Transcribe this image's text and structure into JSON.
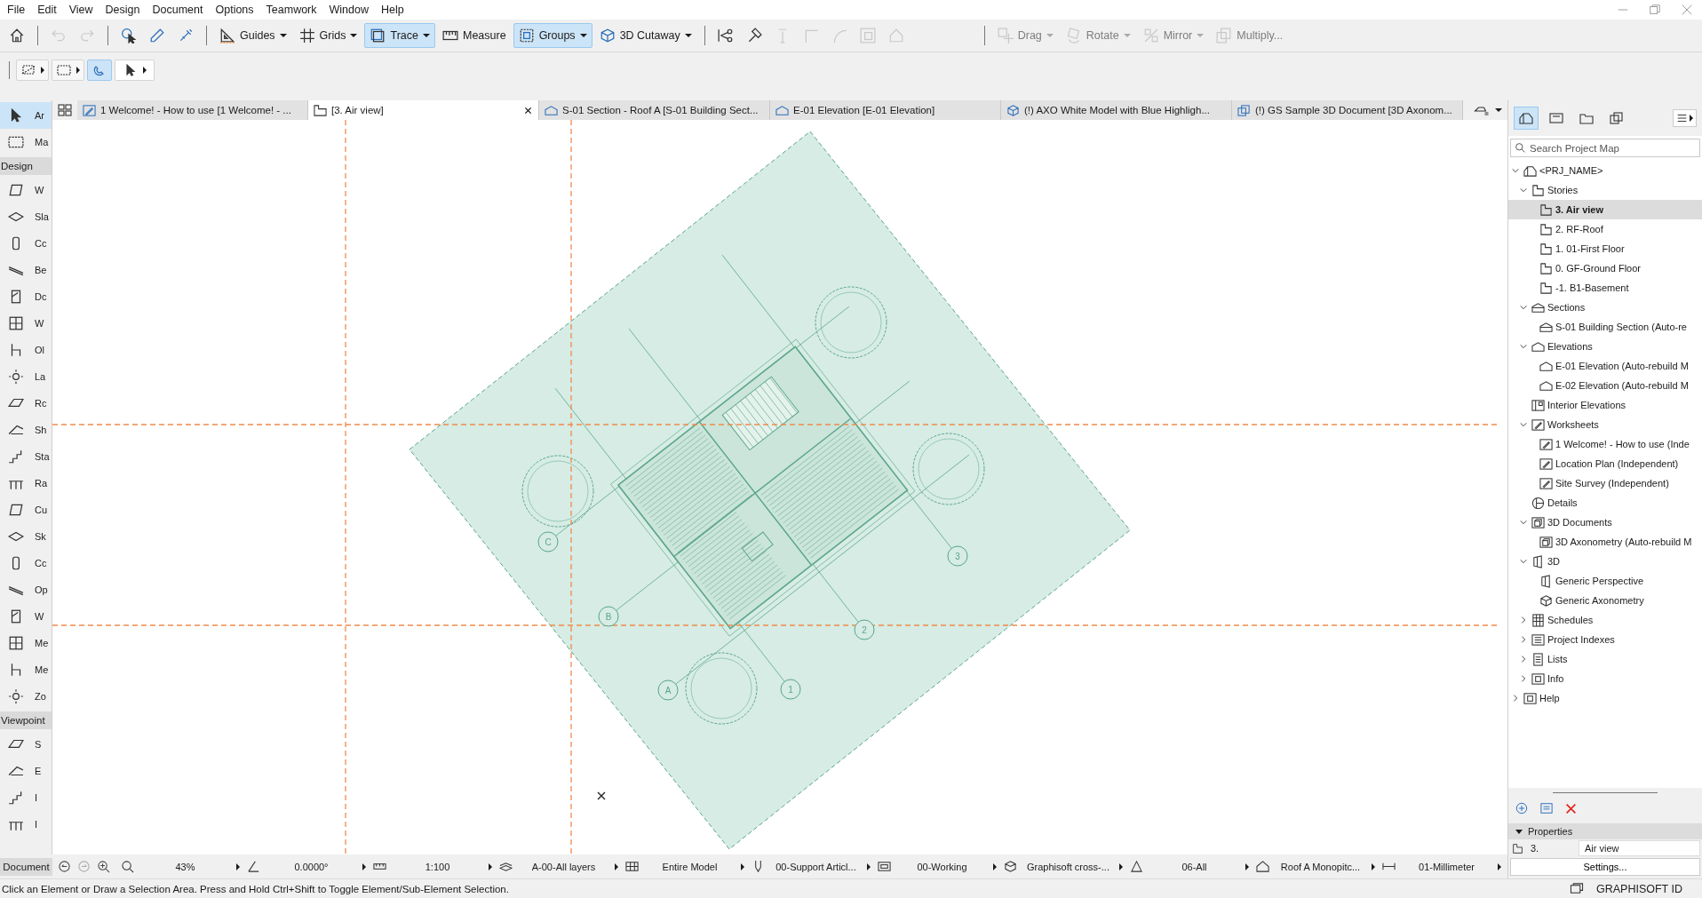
{
  "menu": [
    "File",
    "Edit",
    "View",
    "Design",
    "Document",
    "Options",
    "Teamwork",
    "Window",
    "Help"
  ],
  "toolbar": {
    "items": [
      {
        "kind": "button",
        "selected": false,
        "disabled": false
      },
      {
        "kind": "separator"
      },
      {
        "kind": "button",
        "selected": false,
        "disabled": true
      },
      {
        "kind": "button",
        "selected": false,
        "disabled": true
      },
      {
        "kind": "separator"
      },
      {
        "kind": "button",
        "selected": false,
        "disabled": false
      },
      {
        "kind": "button",
        "selected": false,
        "disabled": false
      },
      {
        "kind": "button",
        "selected": false,
        "disabled": false
      },
      {
        "kind": "separator"
      },
      {
        "kind": "button",
        "label": "Guides",
        "dropdown": true,
        "selected": false,
        "disabled": false
      },
      {
        "kind": "button",
        "label": "Grids",
        "dropdown": true,
        "selected": false,
        "disabled": false
      },
      {
        "kind": "button",
        "label": "Trace",
        "dropdown": true,
        "selected": true,
        "disabled": false
      },
      {
        "kind": "button",
        "label": "Measure",
        "selected": false,
        "disabled": false
      },
      {
        "kind": "button",
        "label": "Groups",
        "dropdown": true,
        "selected": true,
        "disabled": false
      },
      {
        "kind": "button",
        "label": "3D Cutaway",
        "dropdown": true,
        "selected": false,
        "disabled": false
      },
      {
        "kind": "separator"
      },
      {
        "kind": "button",
        "selected": false,
        "disabled": false
      },
      {
        "kind": "button",
        "selected": false,
        "disabled": false
      },
      {
        "kind": "button",
        "selected": false,
        "disabled": true
      },
      {
        "kind": "button",
        "selected": false,
        "disabled": true
      },
      {
        "kind": "button",
        "selected": false,
        "disabled": true
      },
      {
        "kind": "button",
        "selected": false,
        "disabled": true
      },
      {
        "kind": "button",
        "selected": false,
        "disabled": true
      },
      {
        "kind": "spacer"
      },
      {
        "kind": "separator"
      },
      {
        "kind": "button",
        "label": "Drag",
        "dropdown": true,
        "selected": false,
        "disabled": true
      },
      {
        "kind": "button",
        "label": "Rotate",
        "dropdown": true,
        "selected": false,
        "disabled": true
      },
      {
        "kind": "button",
        "label": "Mirror",
        "dropdown": true,
        "selected": false,
        "disabled": true
      },
      {
        "kind": "button",
        "label": "Multiply...",
        "selected": false,
        "disabled": true
      }
    ]
  },
  "info_box": [
    {
      "dropdown": true,
      "selected": false
    },
    {
      "dropdown": true,
      "selected": false
    },
    {
      "selected": true
    },
    {
      "dropdown": true,
      "selected": false
    }
  ],
  "tabs": [
    {
      "label": "1 Welcome! - How to use [1 Welcome! - ...",
      "selected": false
    },
    {
      "label": "[3. Air view]",
      "selected": true
    },
    {
      "label": "S-01 Section - Roof A [S-01 Building Sect...",
      "selected": false
    },
    {
      "label": "E-01 Elevation [E-01 Elevation]",
      "selected": false
    },
    {
      "label": "(!) AXO White Model with Blue Highligh...",
      "selected": false
    },
    {
      "label": "(!) GS Sample 3D Document [3D Axonom...",
      "selected": false
    }
  ],
  "toolbox": {
    "items": [
      {
        "kind": "tool",
        "label": "Ar",
        "selected": true
      },
      {
        "kind": "tool",
        "label": "Ma",
        "selected": false
      },
      {
        "kind": "header",
        "label": "Design"
      },
      {
        "kind": "tool",
        "label": "W",
        "selected": false
      },
      {
        "kind": "tool",
        "label": "Sla",
        "selected": false
      },
      {
        "kind": "tool",
        "label": "Cc",
        "selected": false
      },
      {
        "kind": "tool",
        "label": "Be",
        "selected": false
      },
      {
        "kind": "tool",
        "label": "Dc",
        "selected": false
      },
      {
        "kind": "tool",
        "label": "W",
        "selected": false
      },
      {
        "kind": "tool",
        "label": "Ol",
        "selected": false
      },
      {
        "kind": "tool",
        "label": "La",
        "selected": false
      },
      {
        "kind": "tool",
        "label": "Rc",
        "selected": false
      },
      {
        "kind": "tool",
        "label": "Sh",
        "selected": false
      },
      {
        "kind": "tool",
        "label": "Sta",
        "selected": false
      },
      {
        "kind": "tool",
        "label": "Ra",
        "selected": false
      },
      {
        "kind": "tool",
        "label": "Cu",
        "selected": false
      },
      {
        "kind": "tool",
        "label": "Sk",
        "selected": false
      },
      {
        "kind": "tool",
        "label": "Cc",
        "selected": false
      },
      {
        "kind": "tool",
        "label": "Op",
        "selected": false
      },
      {
        "kind": "tool",
        "label": "W",
        "selected": false
      },
      {
        "kind": "tool",
        "label": "Me",
        "selected": false
      },
      {
        "kind": "tool",
        "label": "Me",
        "selected": false
      },
      {
        "kind": "tool",
        "label": "Zo",
        "selected": false
      },
      {
        "kind": "header",
        "label": "Viewpoint"
      },
      {
        "kind": "tool",
        "label": "S",
        "selected": false
      },
      {
        "kind": "tool",
        "label": "E",
        "selected": false
      },
      {
        "kind": "tool",
        "label": "I",
        "selected": false
      },
      {
        "kind": "tool",
        "label": "I",
        "selected": false
      }
    ]
  },
  "canvas": {
    "grid_bubbles": [
      "C",
      "B",
      "A",
      "1",
      "2",
      "3"
    ]
  },
  "project_map": {
    "views": [
      {
        "selected": true
      },
      {
        "selected": false
      },
      {
        "selected": false
      },
      {
        "selected": false
      }
    ],
    "search": {
      "placeholder": "Search Project Map"
    },
    "tree": [
      {
        "label": "<PRJ_NAME>",
        "kind": "project",
        "expanded": true,
        "selected": false,
        "children": [
          {
            "label": "Stories",
            "kind": "story",
            "expanded": true,
            "selected": false,
            "children": [
              {
                "label": "3. Air view",
                "kind": "story",
                "selected": true
              },
              {
                "label": "2. RF-Roof",
                "kind": "story",
                "selected": false
              },
              {
                "label": "1. 01-First Floor",
                "kind": "story",
                "selected": false
              },
              {
                "label": "0. GF-Ground Floor",
                "kind": "story",
                "selected": false
              },
              {
                "label": "-1. B1-Basement",
                "kind": "story",
                "selected": false
              }
            ]
          },
          {
            "label": "Sections",
            "kind": "section",
            "expanded": true,
            "selected": false,
            "children": [
              {
                "label": "S-01 Building Section (Auto-re",
                "kind": "section",
                "selected": false
              }
            ]
          },
          {
            "label": "Elevations",
            "kind": "elevation",
            "expanded": true,
            "selected": false,
            "children": [
              {
                "label": "E-01 Elevation (Auto-rebuild M",
                "kind": "elevation",
                "selected": false
              },
              {
                "label": "E-02 Elevation (Auto-rebuild M",
                "kind": "elevation",
                "selected": false
              }
            ]
          },
          {
            "label": "Interior Elevations",
            "kind": "interior",
            "selected": false
          },
          {
            "label": "Worksheets",
            "kind": "worksheet",
            "expanded": true,
            "selected": false,
            "children": [
              {
                "label": "1 Welcome! - How to use (Inde",
                "kind": "worksheet",
                "selected": false
              },
              {
                "label": "Location Plan (Independent)",
                "kind": "worksheet",
                "selected": false
              },
              {
                "label": "Site Survey (Independent)",
                "kind": "worksheet",
                "selected": false
              }
            ]
          },
          {
            "label": "Details",
            "kind": "detail",
            "selected": false
          },
          {
            "label": "3D Documents",
            "kind": "document3d",
            "expanded": true,
            "selected": false,
            "children": [
              {
                "label": "3D Axonometry (Auto-rebuild M",
                "kind": "document3d",
                "selected": false
              }
            ]
          },
          {
            "label": "3D",
            "kind": "perspective",
            "expanded": true,
            "selected": false,
            "children": [
              {
                "label": "Generic Perspective",
                "kind": "perspective",
                "selected": false
              },
              {
                "label": "Generic Axonometry",
                "kind": "axonometry",
                "selected": false
              }
            ]
          },
          {
            "label": "Schedules",
            "kind": "schedule",
            "expanded": false,
            "selected": false
          },
          {
            "label": "Project Indexes",
            "kind": "index",
            "expanded": false,
            "selected": false
          },
          {
            "label": "Lists",
            "kind": "list",
            "expanded": false,
            "selected": false
          },
          {
            "label": "Info",
            "kind": "info",
            "expanded": false,
            "selected": false
          }
        ]
      },
      {
        "label": "Help",
        "kind": "info",
        "expanded": false,
        "selected": false
      }
    ],
    "properties": {
      "title": "Properties",
      "expanded": true,
      "number": "3.",
      "name": "Air view",
      "button": "Settings..."
    }
  },
  "status_bar": {
    "label": "Document",
    "fields": [
      "43%",
      "0.0000°",
      "1:100",
      "A-00-All layers",
      "Entire Model",
      "00-Support Articl...",
      "00-Working",
      "Graphisoft cross-...",
      "06-All",
      "Roof A Monopitc...",
      "01-Millimeter"
    ],
    "message": "Click an Element or Draw a Selection Area. Press and Hold Ctrl+Shift to Toggle Element/Sub-Element Selection.",
    "account": "GRAPHISOFT ID"
  }
}
